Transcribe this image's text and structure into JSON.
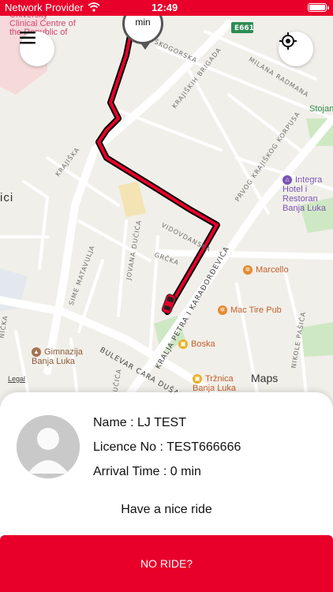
{
  "status_bar": {
    "carrier": "Network Provider",
    "time": "12:49"
  },
  "map": {
    "eta_pin_text": "min",
    "route_color": "#e8002a",
    "streets": {
      "kraljskih_brigada": "KRAJIŠKIH BRIGADA",
      "skogorska": "ŠKOGORSKA",
      "milana_radmana": "MILANA RADMANA",
      "krajiska": "KRAJIŠKA",
      "vidovdanska": "VIDOVDANSKA",
      "prvog_krajiskog": "PRVOG KRAJIŠKOG KORPUSA",
      "jovana_ducica": "JOVANA DUČIĆA",
      "grcka": "GRČKA",
      "sime_matavulja": "SIME MATAVULJA",
      "kralja_petra": "KRALJA PETRA I KARAĐORĐEVIĆA",
      "bulevar_cara_dusana": "BULEVAR CARA DUŠANA",
      "nikole_pasica": "NIKOLE PAŠIĆA",
      "ducica_short": "UČIĆA",
      "nicka_short": "NIČKA"
    },
    "road_badge": "E661",
    "city_label": "ici",
    "pois": {
      "hospital": "University Clinical Centre of the Republic of",
      "hotel": "Integra Hotel i Restoran Banja Luka",
      "stojan": "Stojan",
      "marcello": "Marcello",
      "mac_tire": "Mac Tire Pub",
      "boska": "Boska",
      "gimnazija": "Gimnazija Banja Luka",
      "trznica": "Tržnica Banja Luka"
    },
    "attribution": "Maps",
    "legal": "Legal"
  },
  "driver": {
    "name_line": "Name :  LJ TEST",
    "licence_line": "Licence No : TEST666666",
    "arrival_line": "Arrival Time : 0 min"
  },
  "farewell": "Have a nice ride",
  "no_ride_button": "NO RIDE?"
}
